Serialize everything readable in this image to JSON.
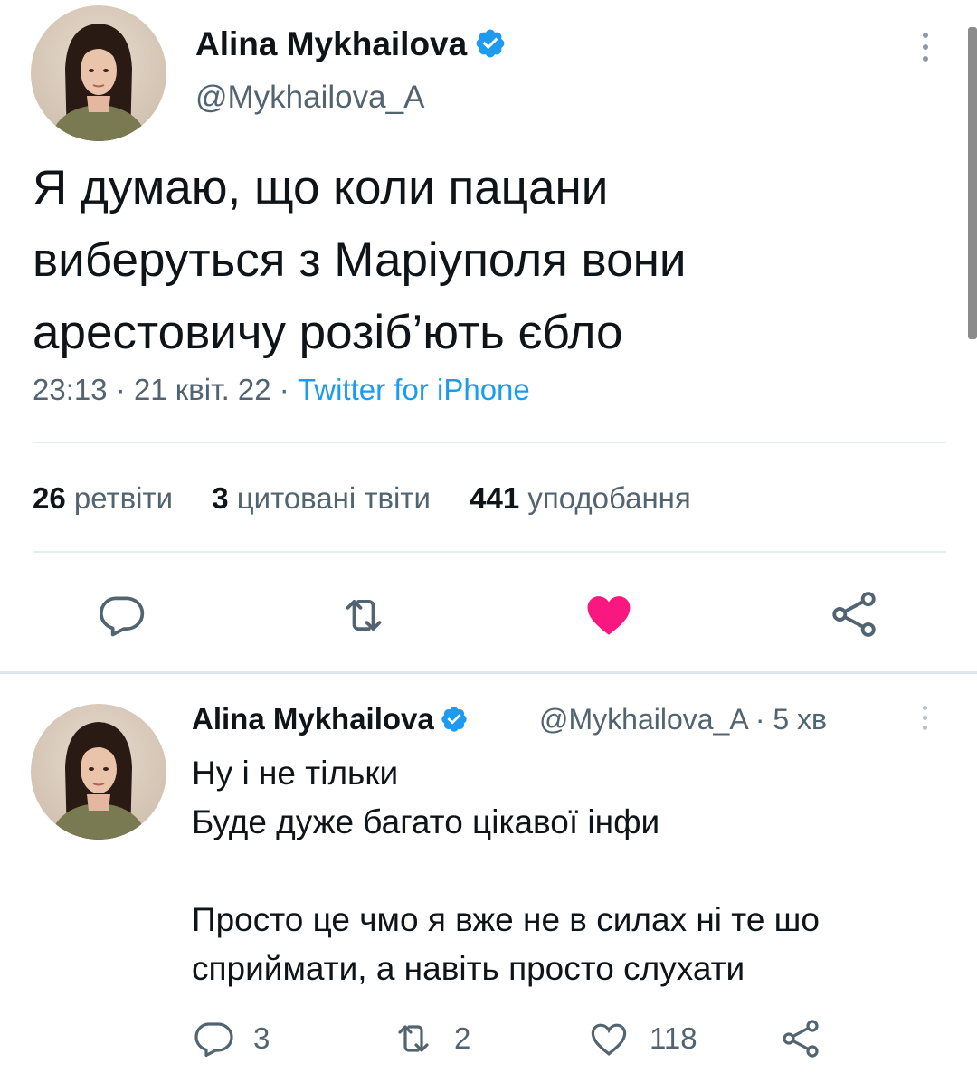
{
  "tweet": {
    "author": {
      "name": "Alina Mykhailova",
      "handle": "@Mykhailova_A",
      "avatar_icon": "avatar-photo",
      "verified_icon": "verified-badge-icon"
    },
    "text_lines": [
      "Я думаю, що коли пацани",
      "виберуться з Маріуполя вони",
      "арестовичу розіб’ють єбло"
    ],
    "time": "23:13",
    "date": "21 квіт. 22",
    "separator": "·",
    "source": "Twitter for iPhone",
    "stats": {
      "retweets_count": "26",
      "retweets_label": "ретвіти",
      "quotes_count": "3",
      "quotes_label": "цитовані твіти",
      "likes_count": "441",
      "likes_label": "уподобання"
    },
    "actions": {
      "reply_icon": "reply-icon",
      "retweet_icon": "retweet-icon",
      "like_icon": "heart-filled-icon",
      "share_icon": "share-icon",
      "like_color": "#f91880"
    }
  },
  "reply": {
    "author": {
      "name": "Alina Mykhailova",
      "handle": "@Mykhailova_A",
      "time_sep": "·",
      "time": "5 хв"
    },
    "text_lines": [
      "Ну і не тільки",
      "Буде дуже багато цікавої інфи",
      "",
      "Просто це чмо я вже не в силах ні те шо",
      "сприймати, а навіть просто слухати"
    ],
    "actions": {
      "reply_count": "3",
      "retweet_count": "2",
      "like_count": "118"
    }
  },
  "colors": {
    "accent": "#1d9bf0",
    "text": "#0f1419",
    "secondary": "#536471"
  }
}
